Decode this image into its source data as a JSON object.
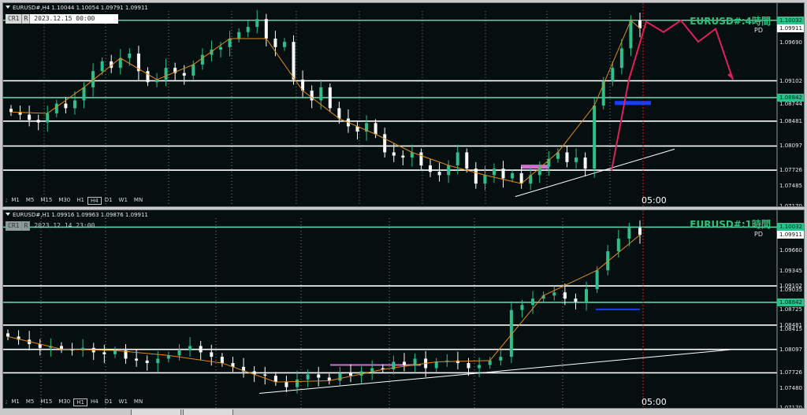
{
  "colors": {
    "background": "#050f0f",
    "bull": "#2fbf8a",
    "bear": "#ffffff",
    "level_white": "#ffffff",
    "level_green": "#5fd0a8",
    "zigzag": "#e08a1e",
    "projection": "#e0205a",
    "box_magenta": "#d070d0",
    "box_blue": "#1a3cff",
    "trend_white": "#ffffff",
    "vline": "#cc2020"
  },
  "top": {
    "header": "EURUSD#,H4  1.10044 1.10054 1.09791 1.09911",
    "cr": "CR1",
    "r": "R",
    "datetime": "2023.12.15 00:00",
    "title": "EURUSD#:4時間",
    "pd": "PD",
    "timeframes": [
      "M1",
      "M5",
      "M15",
      "M30",
      "H1",
      "H4",
      "D1",
      "W1",
      "MN"
    ],
    "selected_tf": "H4",
    "time_label": "05:00",
    "price_labels": [
      "1.10032",
      "1.09911",
      "1.09690",
      "1.09102",
      "1.08842",
      "1.08744",
      "1.08481",
      "1.08097",
      "1.07726",
      "1.07485",
      "1.07170"
    ]
  },
  "bottom": {
    "header": "EURUSD#,H1  1.09916 1.09963 1.09876 1.09911",
    "cr": "CR1",
    "r": "R",
    "datetime": "2023.12.14 23:00",
    "title": "EURUSD#:1時間",
    "pd": "PD",
    "timeframes": [
      "M1",
      "M5",
      "M15",
      "M30",
      "H1",
      "H4",
      "D1",
      "W1",
      "MN"
    ],
    "selected_tf": "H1",
    "time_label": "05:00",
    "price_labels": [
      "1.10032",
      "1.09911",
      "1.09660",
      "1.09345",
      "1.09102",
      "1.09035",
      "1.08842",
      "1.08725",
      "1.08481",
      "1.08415",
      "1.08097",
      "1.07726",
      "1.07480",
      "1.07170"
    ]
  },
  "chart_data": [
    {
      "type": "candlestick",
      "symbol": "EURUSD#",
      "timeframe": "H4",
      "title": "EURUSD#:4時間",
      "ylim": [
        1.0717,
        1.1015
      ],
      "last_price": 1.09911,
      "levels": [
        {
          "price": 1.10032,
          "color": "green"
        },
        {
          "price": 1.09102,
          "color": "white"
        },
        {
          "price": 1.08842,
          "color": "green"
        },
        {
          "price": 1.08481,
          "color": "white"
        },
        {
          "price": 1.08097,
          "color": "white"
        },
        {
          "price": 1.07726,
          "color": "white"
        }
      ],
      "series": [
        {
          "name": "close",
          "values": [
            1.0862,
            1.0858,
            1.085,
            1.0846,
            1.086,
            1.0875,
            1.0868,
            1.088,
            1.09,
            1.0925,
            1.094,
            1.093,
            1.0945,
            1.0952,
            1.0925,
            1.0908,
            1.0912,
            1.093,
            1.0922,
            1.0918,
            1.0935,
            1.095,
            1.0958,
            1.0962,
            1.0975,
            1.0985,
            1.0993,
            1.1005,
            1.0975,
            1.0962,
            1.097,
            1.0912,
            1.0895,
            1.088,
            1.09,
            1.0868,
            1.0852,
            1.084,
            1.0832,
            1.0845,
            1.0828,
            1.08,
            1.0795,
            1.0792,
            1.08,
            1.078,
            1.077,
            1.0765,
            1.078,
            1.08,
            1.0775,
            1.0752,
            1.0765,
            1.0775,
            1.076,
            1.0768,
            1.0752,
            1.0765,
            1.0778,
            1.079,
            1.08,
            1.0785,
            1.0792,
            1.0775,
            1.0872,
            1.091,
            1.093,
            1.096,
            1.1003,
            1.0991
          ]
        },
        {
          "name": "projection",
          "values": [
            1.0772,
            1.0912,
            1.1001,
            1.0985,
            1.1003,
            1.097,
            1.099,
            1.0912
          ]
        }
      ]
    },
    {
      "type": "candlestick",
      "symbol": "EURUSD#",
      "timeframe": "H1",
      "title": "EURUSD#:1時間",
      "ylim": [
        1.0717,
        1.1015
      ],
      "last_price": 1.09911,
      "levels": [
        {
          "price": 1.10032,
          "color": "green"
        },
        {
          "price": 1.09102,
          "color": "white"
        },
        {
          "price": 1.08842,
          "color": "green"
        },
        {
          "price": 1.08481,
          "color": "white"
        },
        {
          "price": 1.08097,
          "color": "white"
        },
        {
          "price": 1.07726,
          "color": "white"
        }
      ],
      "series": [
        {
          "name": "close",
          "values": [
            1.083,
            1.0825,
            1.0818,
            1.0812,
            1.0815,
            1.081,
            1.0808,
            1.0812,
            1.0805,
            1.0802,
            1.0808,
            1.0795,
            1.0792,
            1.0788,
            1.0795,
            1.08,
            1.0808,
            1.0815,
            1.0805,
            1.0798,
            1.0788,
            1.0782,
            1.0775,
            1.077,
            1.0768,
            1.0758,
            1.075,
            1.0762,
            1.077,
            1.0765,
            1.076,
            1.0772,
            1.0768,
            1.0775,
            1.078,
            1.0778,
            1.079,
            1.0785,
            1.0795,
            1.078,
            1.079,
            1.0792,
            1.0788,
            1.078,
            1.0785,
            1.0792,
            1.0798,
            1.0872,
            1.088,
            1.089,
            1.0895,
            1.09,
            1.089,
            1.0885,
            1.0905,
            1.0935,
            1.0965,
            1.0985,
            1.1002,
            1.0991
          ]
        }
      ]
    }
  ]
}
